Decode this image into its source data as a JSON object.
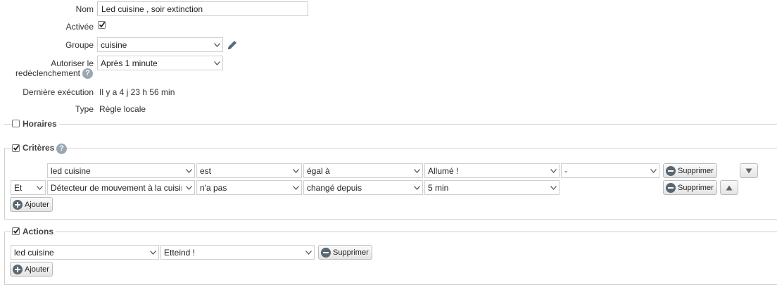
{
  "form": {
    "nom_label": "Nom",
    "nom_value": "Led cuisine , soir extinction",
    "activee_label": "Activée",
    "activee_checked": true,
    "groupe_label": "Groupe",
    "groupe_value": "cuisine",
    "autoriser_label_line1": "Autoriser le",
    "autoriser_label_line2": "redéclenchement",
    "autoriser_value": "Après 1 minute",
    "derniere_label": "Dernière exécution",
    "derniere_value": "Il y a 4 j 23 h 56 min",
    "type_label": "Type",
    "type_value": "Règle locale"
  },
  "horaires": {
    "title": "Horaires",
    "checked": false
  },
  "criteres": {
    "title": "Critères",
    "checked": true,
    "rows": [
      {
        "connector": "",
        "device": "led cuisine",
        "verb": "est",
        "operator": "égal à",
        "value": "Allumé !",
        "extra": "-",
        "delete_label": "Supprimer",
        "move": "down"
      },
      {
        "connector": "Et",
        "device": "Détecteur de mouvement à la cuisine",
        "verb": "n'a pas",
        "operator": "changé depuis",
        "value": "5 min",
        "extra": null,
        "delete_label": "Supprimer",
        "move": "up"
      }
    ],
    "add_label": "Ajouter"
  },
  "actions": {
    "title": "Actions",
    "checked": true,
    "rows": [
      {
        "device": "led cuisine",
        "action": "Etteind !",
        "delete_label": "Supprimer"
      }
    ],
    "add_label": "Ajouter"
  },
  "icons": {
    "edit": "pencil-icon",
    "help": "question-icon",
    "dropdown": "chevron-down-icon",
    "delete": "minus-circle-icon",
    "add": "plus-circle-icon",
    "move_down": "triangle-down-icon",
    "move_up": "triangle-up-icon"
  },
  "colors": {
    "help_icon": "#9aa7b3",
    "button_icon": "#5a6670",
    "border": "#cfcfcf"
  }
}
